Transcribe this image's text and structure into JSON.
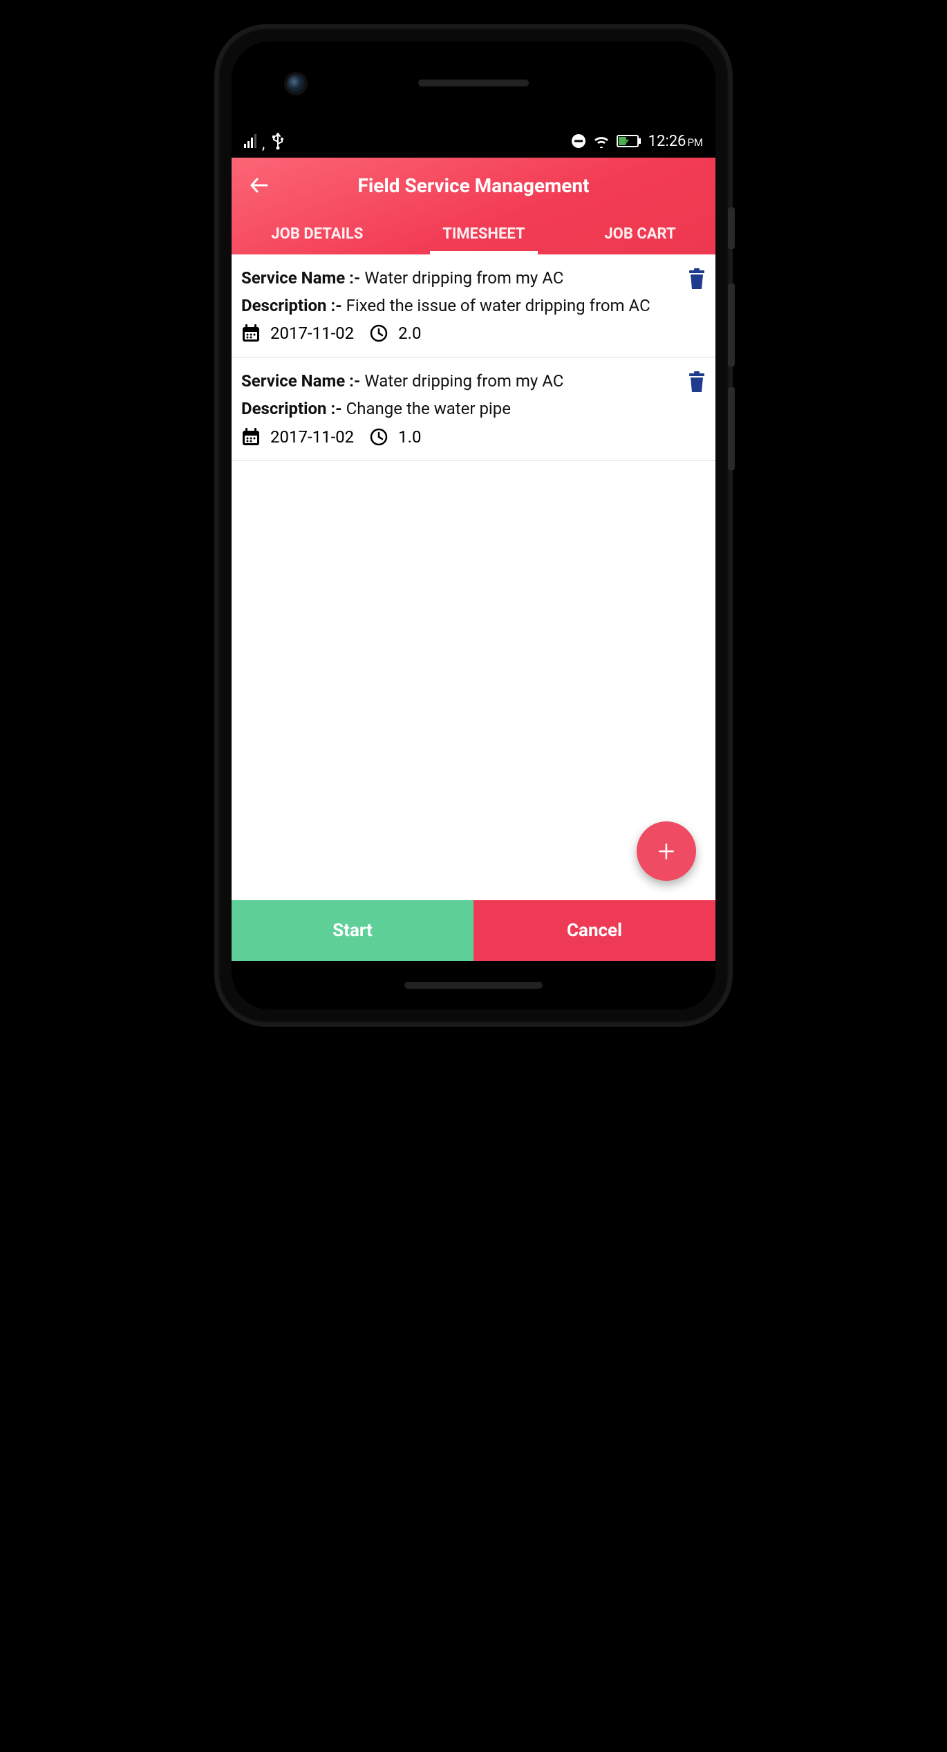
{
  "status_bar": {
    "time": "12:26",
    "period": "PM"
  },
  "header": {
    "title": "Field Service Management"
  },
  "tabs": {
    "job_details": "JOB DETAILS",
    "timesheet": "TIMESHEET",
    "job_cart": "JOB CART"
  },
  "labels": {
    "service_name": "Service Name :-",
    "description": "Description :-"
  },
  "entries": [
    {
      "service_name": "Water dripping from my AC",
      "description": "Fixed the issue of water dripping from AC",
      "date": "2017-11-02",
      "hours": "2.0"
    },
    {
      "service_name": "Water dripping from my AC",
      "description": "Change the water pipe",
      "date": "2017-11-02",
      "hours": "1.0"
    }
  ],
  "buttons": {
    "start": "Start",
    "cancel": "Cancel",
    "fab": "+"
  },
  "colors": {
    "accent": "#ef3a55",
    "success": "#5fcf98",
    "delete_icon": "#1f3b8e"
  }
}
